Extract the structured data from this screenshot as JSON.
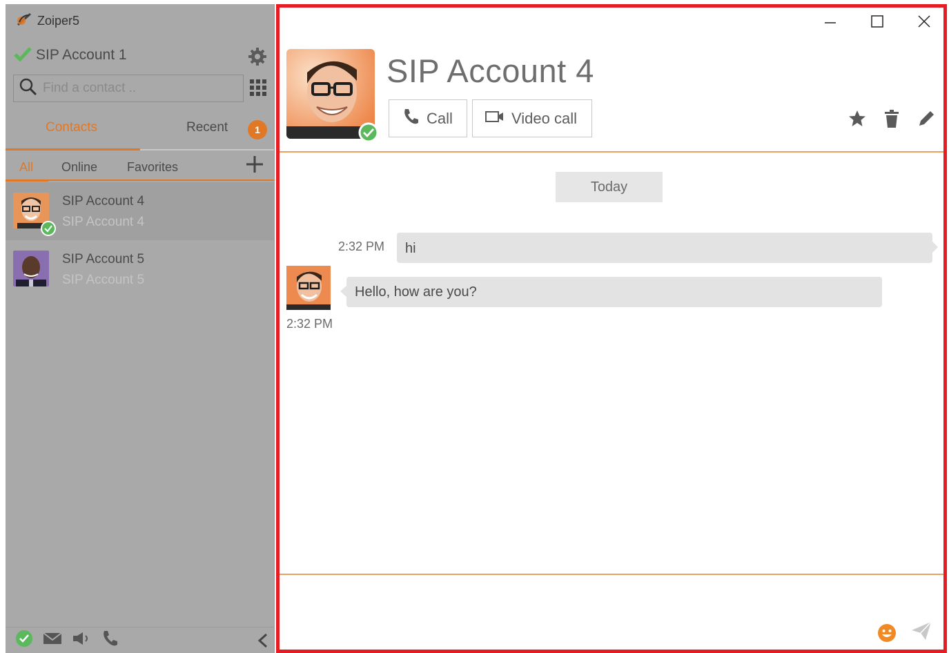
{
  "app": {
    "title": "Zoiper5"
  },
  "account": {
    "name": "SIP Account 1"
  },
  "search": {
    "placeholder": "Find a contact .."
  },
  "tabs": {
    "contacts": "Contacts",
    "recent": "Recent",
    "recent_badge": "1"
  },
  "filters": {
    "all": "All",
    "online": "Online",
    "favorites": "Favorites"
  },
  "contacts": [
    {
      "name": "SIP Account 4",
      "sub": "SIP Account 4"
    },
    {
      "name": "SIP Account 5",
      "sub": "SIP Account 5"
    }
  ],
  "conversation": {
    "title": "SIP Account 4",
    "call_label": "Call",
    "video_label": "Video call",
    "date_divider": "Today",
    "messages": [
      {
        "direction": "outgoing",
        "time": "2:32 PM",
        "text": "hi"
      },
      {
        "direction": "incoming",
        "time": "2:32 PM",
        "text": "Hello, how are you?"
      }
    ]
  },
  "colors": {
    "accent": "#e07826",
    "highlight_border": "#e51c23",
    "presence": "#5cb85c"
  }
}
